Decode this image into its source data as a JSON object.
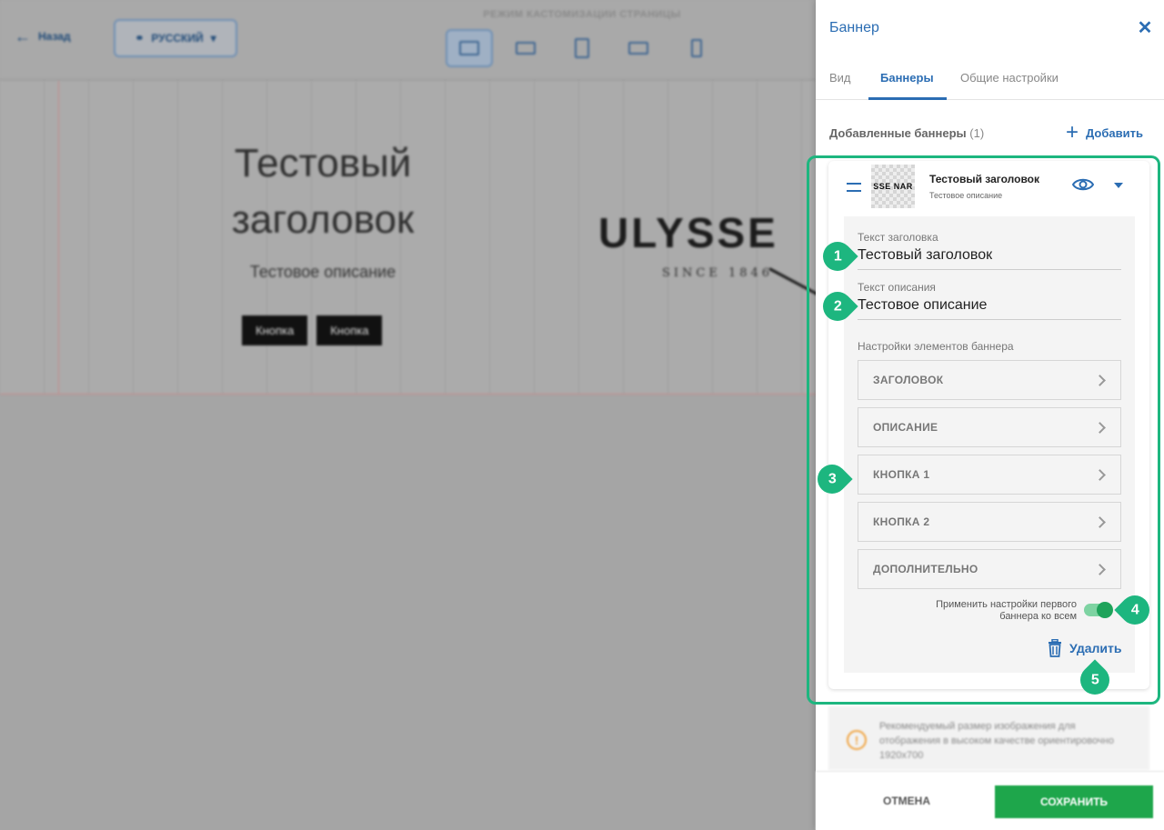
{
  "editor": {
    "back_label": "Назад",
    "language_label": "РУССКИЙ",
    "mode_title": "РЕЖИМ КАСТОМИЗАЦИИ СТРАНИЦЫ",
    "hero_title_line1": "Тестовый",
    "hero_title_line2": "заголовок",
    "hero_description": "Тестовое описание",
    "hero_button1": "Кнопка",
    "hero_button2": "Кнопка",
    "logo_word": "ULYSSE",
    "logo_since": "SINCE 1846"
  },
  "panel": {
    "title": "Баннер",
    "tabs": [
      {
        "label": "Вид"
      },
      {
        "label": "Баннеры"
      },
      {
        "label": "Общие настройки"
      }
    ],
    "added_label": "Добавленные баннеры",
    "added_count": "(1)",
    "add_label": "Добавить",
    "banner": {
      "thumb_text": "SSE NAR",
      "title": "Тестовый заголовок",
      "subtitle": "Тестовое описание",
      "heading_field_label": "Текст заголовка",
      "heading_field_value": "Тестовый заголовок",
      "desc_field_label": "Текст описания",
      "desc_field_value": "Тестовое описание",
      "section_label": "Настройки элементов баннера",
      "accordions": [
        {
          "label": "ЗАГОЛОВОК"
        },
        {
          "label": "ОПИСАНИЕ"
        },
        {
          "label": "КНОПКА 1"
        },
        {
          "label": "КНОПКА 2"
        },
        {
          "label": "ДОПОЛНИТЕЛЬНО"
        }
      ],
      "apply_all_label": "Применить настройки первого баннера ко всем",
      "delete_label": "Удалить"
    },
    "hint_text": "Рекомендуемый размер изображения для отображения в высоком качестве ориентировочно 1920x700",
    "cancel_label": "ОТМЕНА",
    "save_label": "СОХРАНИТЬ"
  },
  "markers": [
    "1",
    "2",
    "3",
    "4",
    "5"
  ],
  "colors": {
    "accent": "#2b6db3",
    "highlight": "#1db67f",
    "save": "#1ea64b",
    "toggle_on": "#1ea35a"
  }
}
